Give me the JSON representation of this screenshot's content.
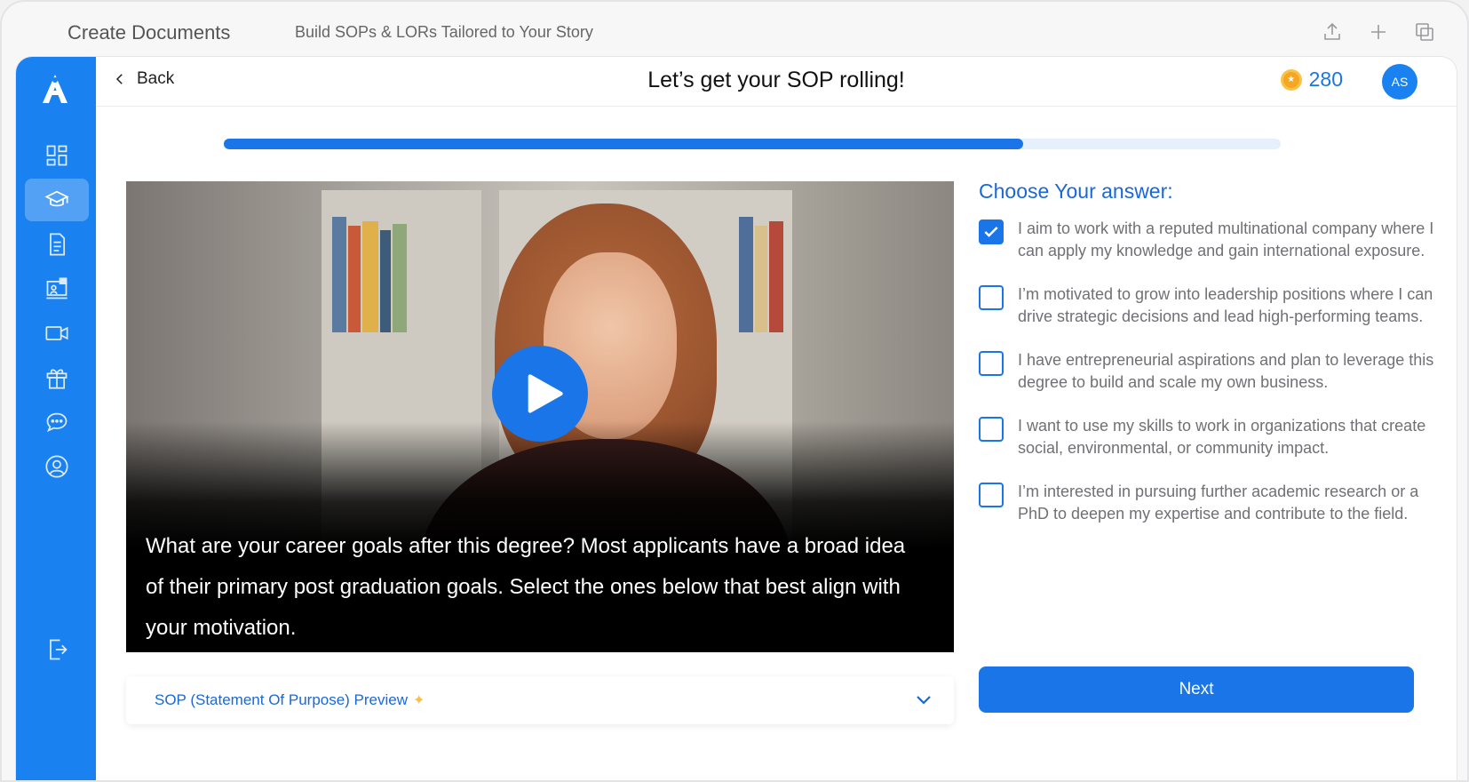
{
  "window": {
    "title": "Create Documents",
    "subtitle": "Build SOPs & LORs Tailored to Your Story",
    "icons": [
      "share-icon",
      "plus-icon",
      "duplicate-icon"
    ]
  },
  "sidebar": {
    "logo": "A",
    "items": [
      {
        "icon": "dashboard-icon",
        "active": false
      },
      {
        "icon": "graduation-cap-icon",
        "active": true
      },
      {
        "icon": "document-icon",
        "active": false
      },
      {
        "icon": "presentation-icon",
        "active": false
      },
      {
        "icon": "video-camera-icon",
        "active": false
      },
      {
        "icon": "gift-icon",
        "active": false
      },
      {
        "icon": "chat-icon",
        "active": false
      },
      {
        "icon": "user-profile-icon",
        "active": false
      },
      {
        "icon": "logout-icon",
        "active": false
      }
    ]
  },
  "header": {
    "back_label": "Back",
    "title": "Let’s get your SOP rolling!",
    "coins": "280",
    "avatar_initials": "AS"
  },
  "progress": {
    "percent": 75.6
  },
  "video": {
    "caption": "What are your career goals after this degree? Most applicants have a broad idea of their primary post graduation goals. Select the ones below that best align with your motivation."
  },
  "preview": {
    "label": "SOP (Statement Of Purpose) Preview"
  },
  "answers": {
    "heading": "Choose Your answer:",
    "options": [
      {
        "text": "I aim to work with a reputed multinational company where I can apply my knowledge and gain international exposure.",
        "checked": true
      },
      {
        "text": "I’m motivated to grow into leadership positions where I can drive strategic decisions and lead high-performing teams.",
        "checked": false
      },
      {
        "text": "I have entrepreneurial aspirations and plan to leverage this degree to build and scale my own business.",
        "checked": false
      },
      {
        "text": "I want to use my skills to work in organizations that create social, environmental, or community impact.",
        "checked": false
      },
      {
        "text": "I’m interested in pursuing further academic research or a PhD to deepen my expertise and contribute to the field.",
        "checked": false
      }
    ],
    "next_label": "Next"
  },
  "colors": {
    "brand": "#1a82f0",
    "accent": "#1a76e8",
    "coin": "#f5a623"
  }
}
